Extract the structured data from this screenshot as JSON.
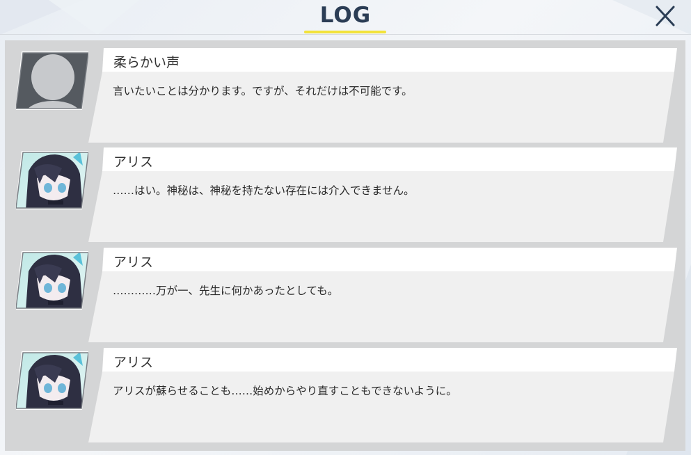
{
  "window": {
    "title": "LOG",
    "accent_color": "#f2e23b",
    "title_color": "#2b3d55"
  },
  "close_icon": "close-icon",
  "log": {
    "entries": [
      {
        "speaker": "柔らかい声",
        "text": "言いたいことは分かります。ですが、それだけは不可能です。",
        "avatar": "silhouette-avatar"
      },
      {
        "speaker": "アリス",
        "text": "……はい。神秘は、神秘を持たない存在には介入できません。",
        "avatar": "character-portrait-aris"
      },
      {
        "speaker": "アリス",
        "text": "…………万が一、先生に何かあったとしても。",
        "avatar": "character-portrait-aris"
      },
      {
        "speaker": "アリス",
        "text": "アリスが蘇らせることも……始めからやり直すこともできないように。",
        "avatar": "character-portrait-aris"
      }
    ]
  }
}
